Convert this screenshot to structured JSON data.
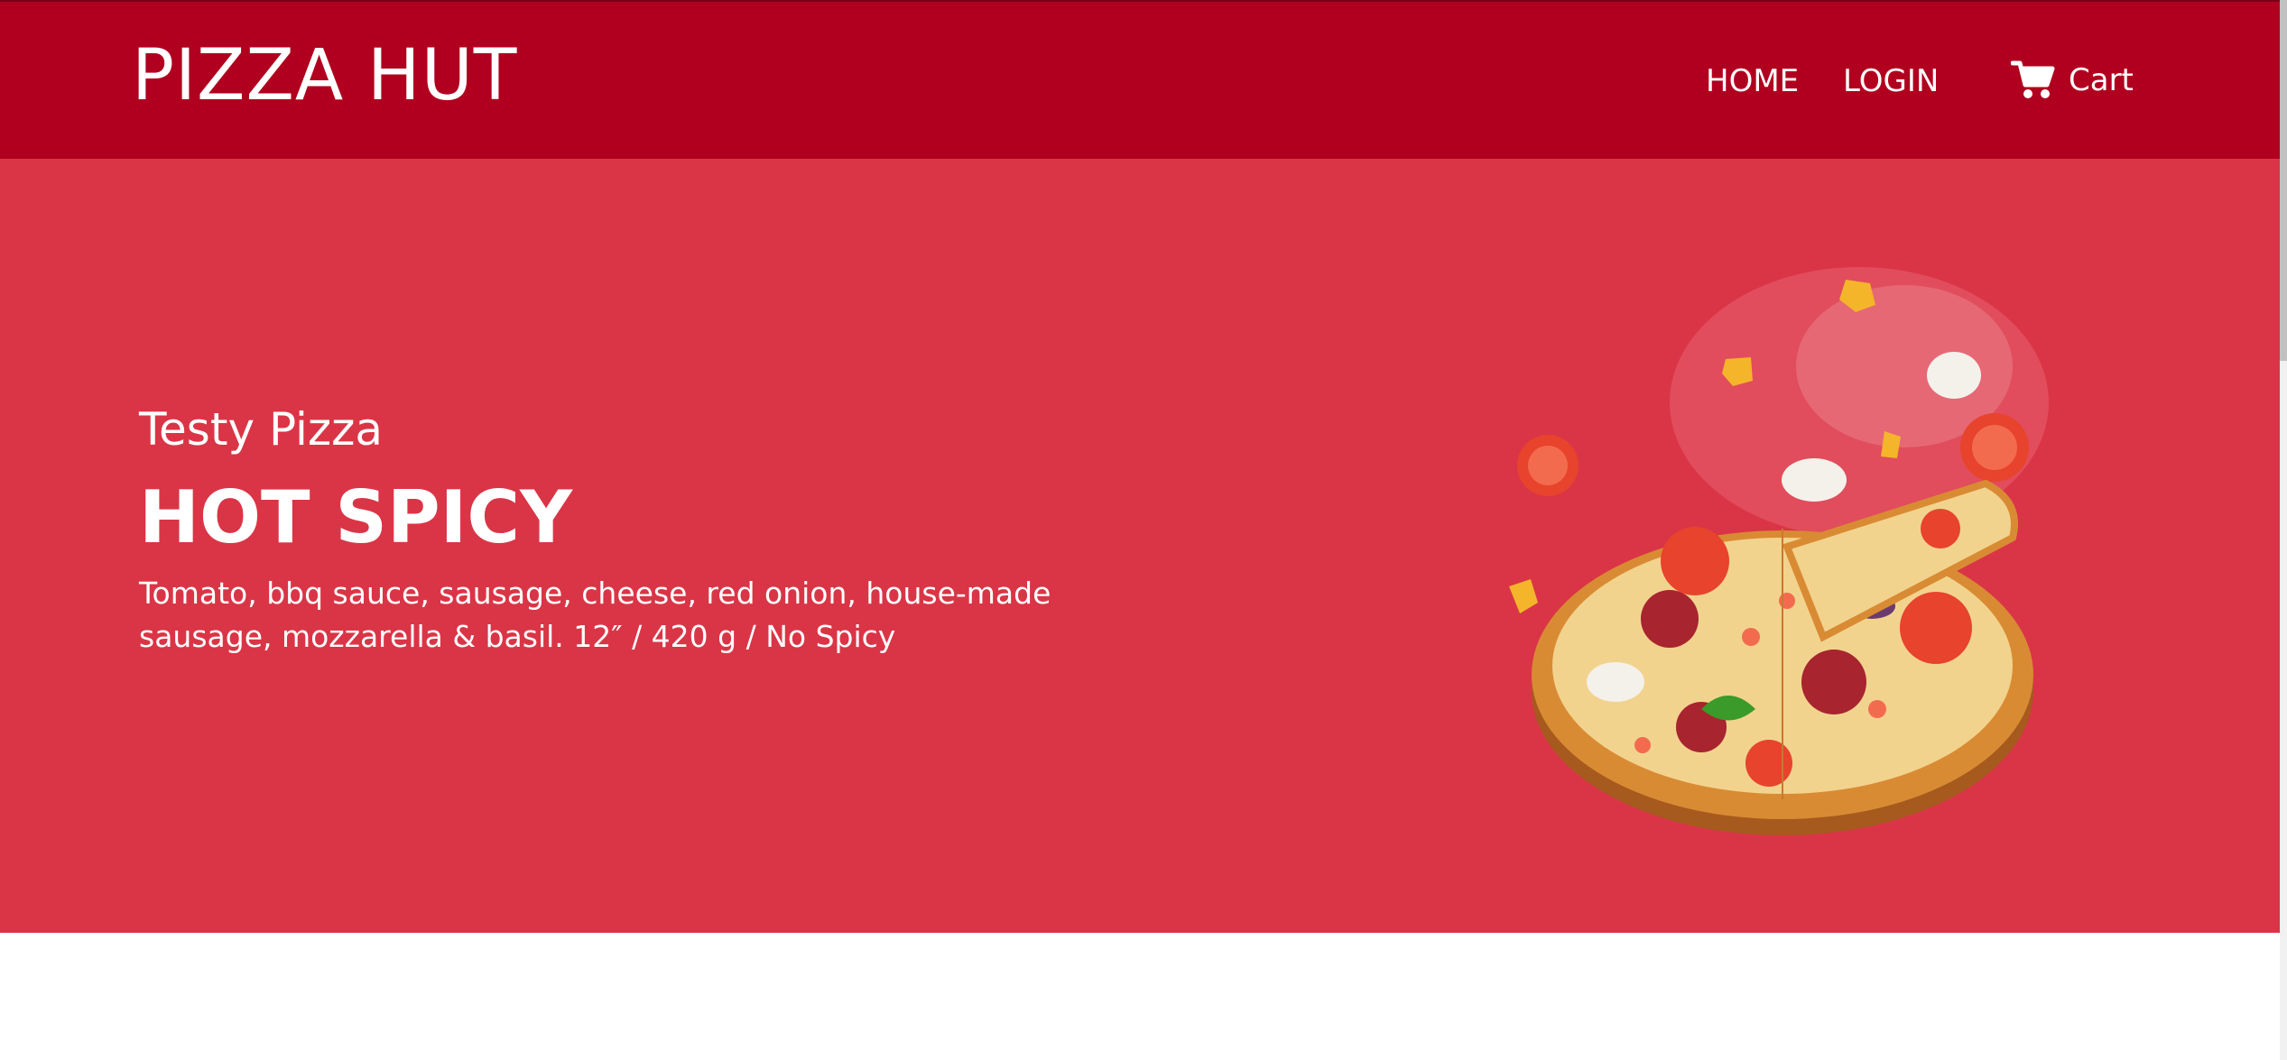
{
  "navbar": {
    "brand": "PIZZA HUT",
    "links": [
      {
        "label": "HOME"
      },
      {
        "label": "LOGIN"
      }
    ],
    "cart": {
      "label": "Cart",
      "icon": "cart-icon"
    }
  },
  "hero": {
    "subtitle": "Testy Pizza",
    "title": "HOT SPICY",
    "description": "Tomato, bbq sauce, sausage, cheese, red onion, house-made sausage, mozzarella & basil. 12″ / 420 g / No Spicy",
    "image": "pizza-image"
  },
  "colors": {
    "navbar": "#b1001f",
    "hero": "#da3546",
    "text": "#ffffff"
  }
}
